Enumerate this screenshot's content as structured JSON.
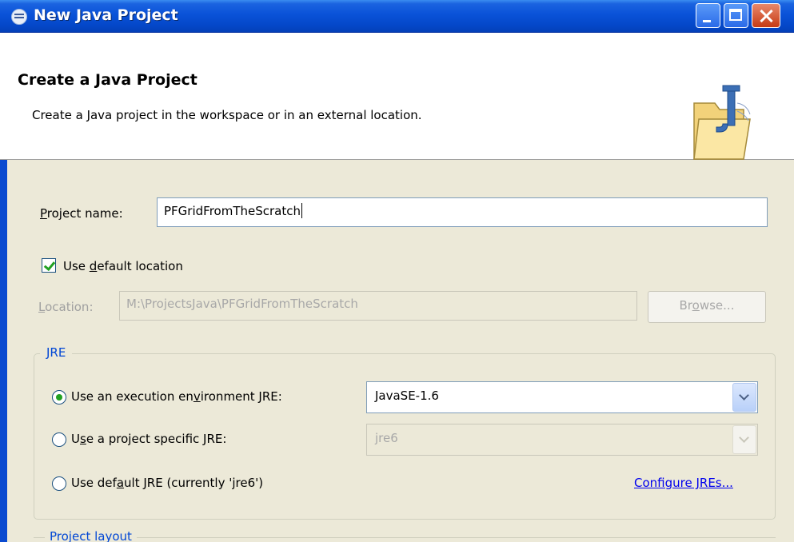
{
  "window": {
    "title": "New Java Project"
  },
  "banner": {
    "title": "Create a Java Project",
    "description": "Create a Java project in the workspace or in an external location."
  },
  "project_name": {
    "label_prefix": "",
    "label_mnemonic": "P",
    "label_rest": "roject name:",
    "value": "PFGridFromTheScratch"
  },
  "use_default_location": {
    "label_prefix": "Use ",
    "label_mnemonic": "d",
    "label_rest": "efault location",
    "checked": true
  },
  "location": {
    "label_mnemonic": "L",
    "label_rest": "ocation:",
    "value": "M:\\ProjectsJava\\PFGridFromTheScratch",
    "enabled": false
  },
  "browse_button": {
    "label_prefix": "Br",
    "label_mnemonic": "o",
    "label_rest": "wse...",
    "enabled": false
  },
  "jre": {
    "group_title": "JRE",
    "option_exec_env": {
      "label_prefix": "Use an execution en",
      "label_mnemonic": "v",
      "label_rest": "ironment JRE:",
      "selected": true,
      "combo_value": "JavaSE-1.6"
    },
    "option_project_specific": {
      "label_prefix": "U",
      "label_mnemonic": "s",
      "label_rest": "e a project specific JRE:",
      "selected": false,
      "combo_value": "jre6"
    },
    "option_default": {
      "label_prefix": "Use def",
      "label_mnemonic": "a",
      "label_rest": "ult JRE (currently 'jre6')",
      "selected": false
    },
    "configure_link": "Configure JREs..."
  },
  "project_layout": {
    "group_title": "Project layout"
  },
  "colors": {
    "titlebar": "#0a52d8",
    "dialog_bg": "#ece9d8",
    "group_title": "#0046d5",
    "link": "#0000ee",
    "check_green": "#21a121"
  }
}
